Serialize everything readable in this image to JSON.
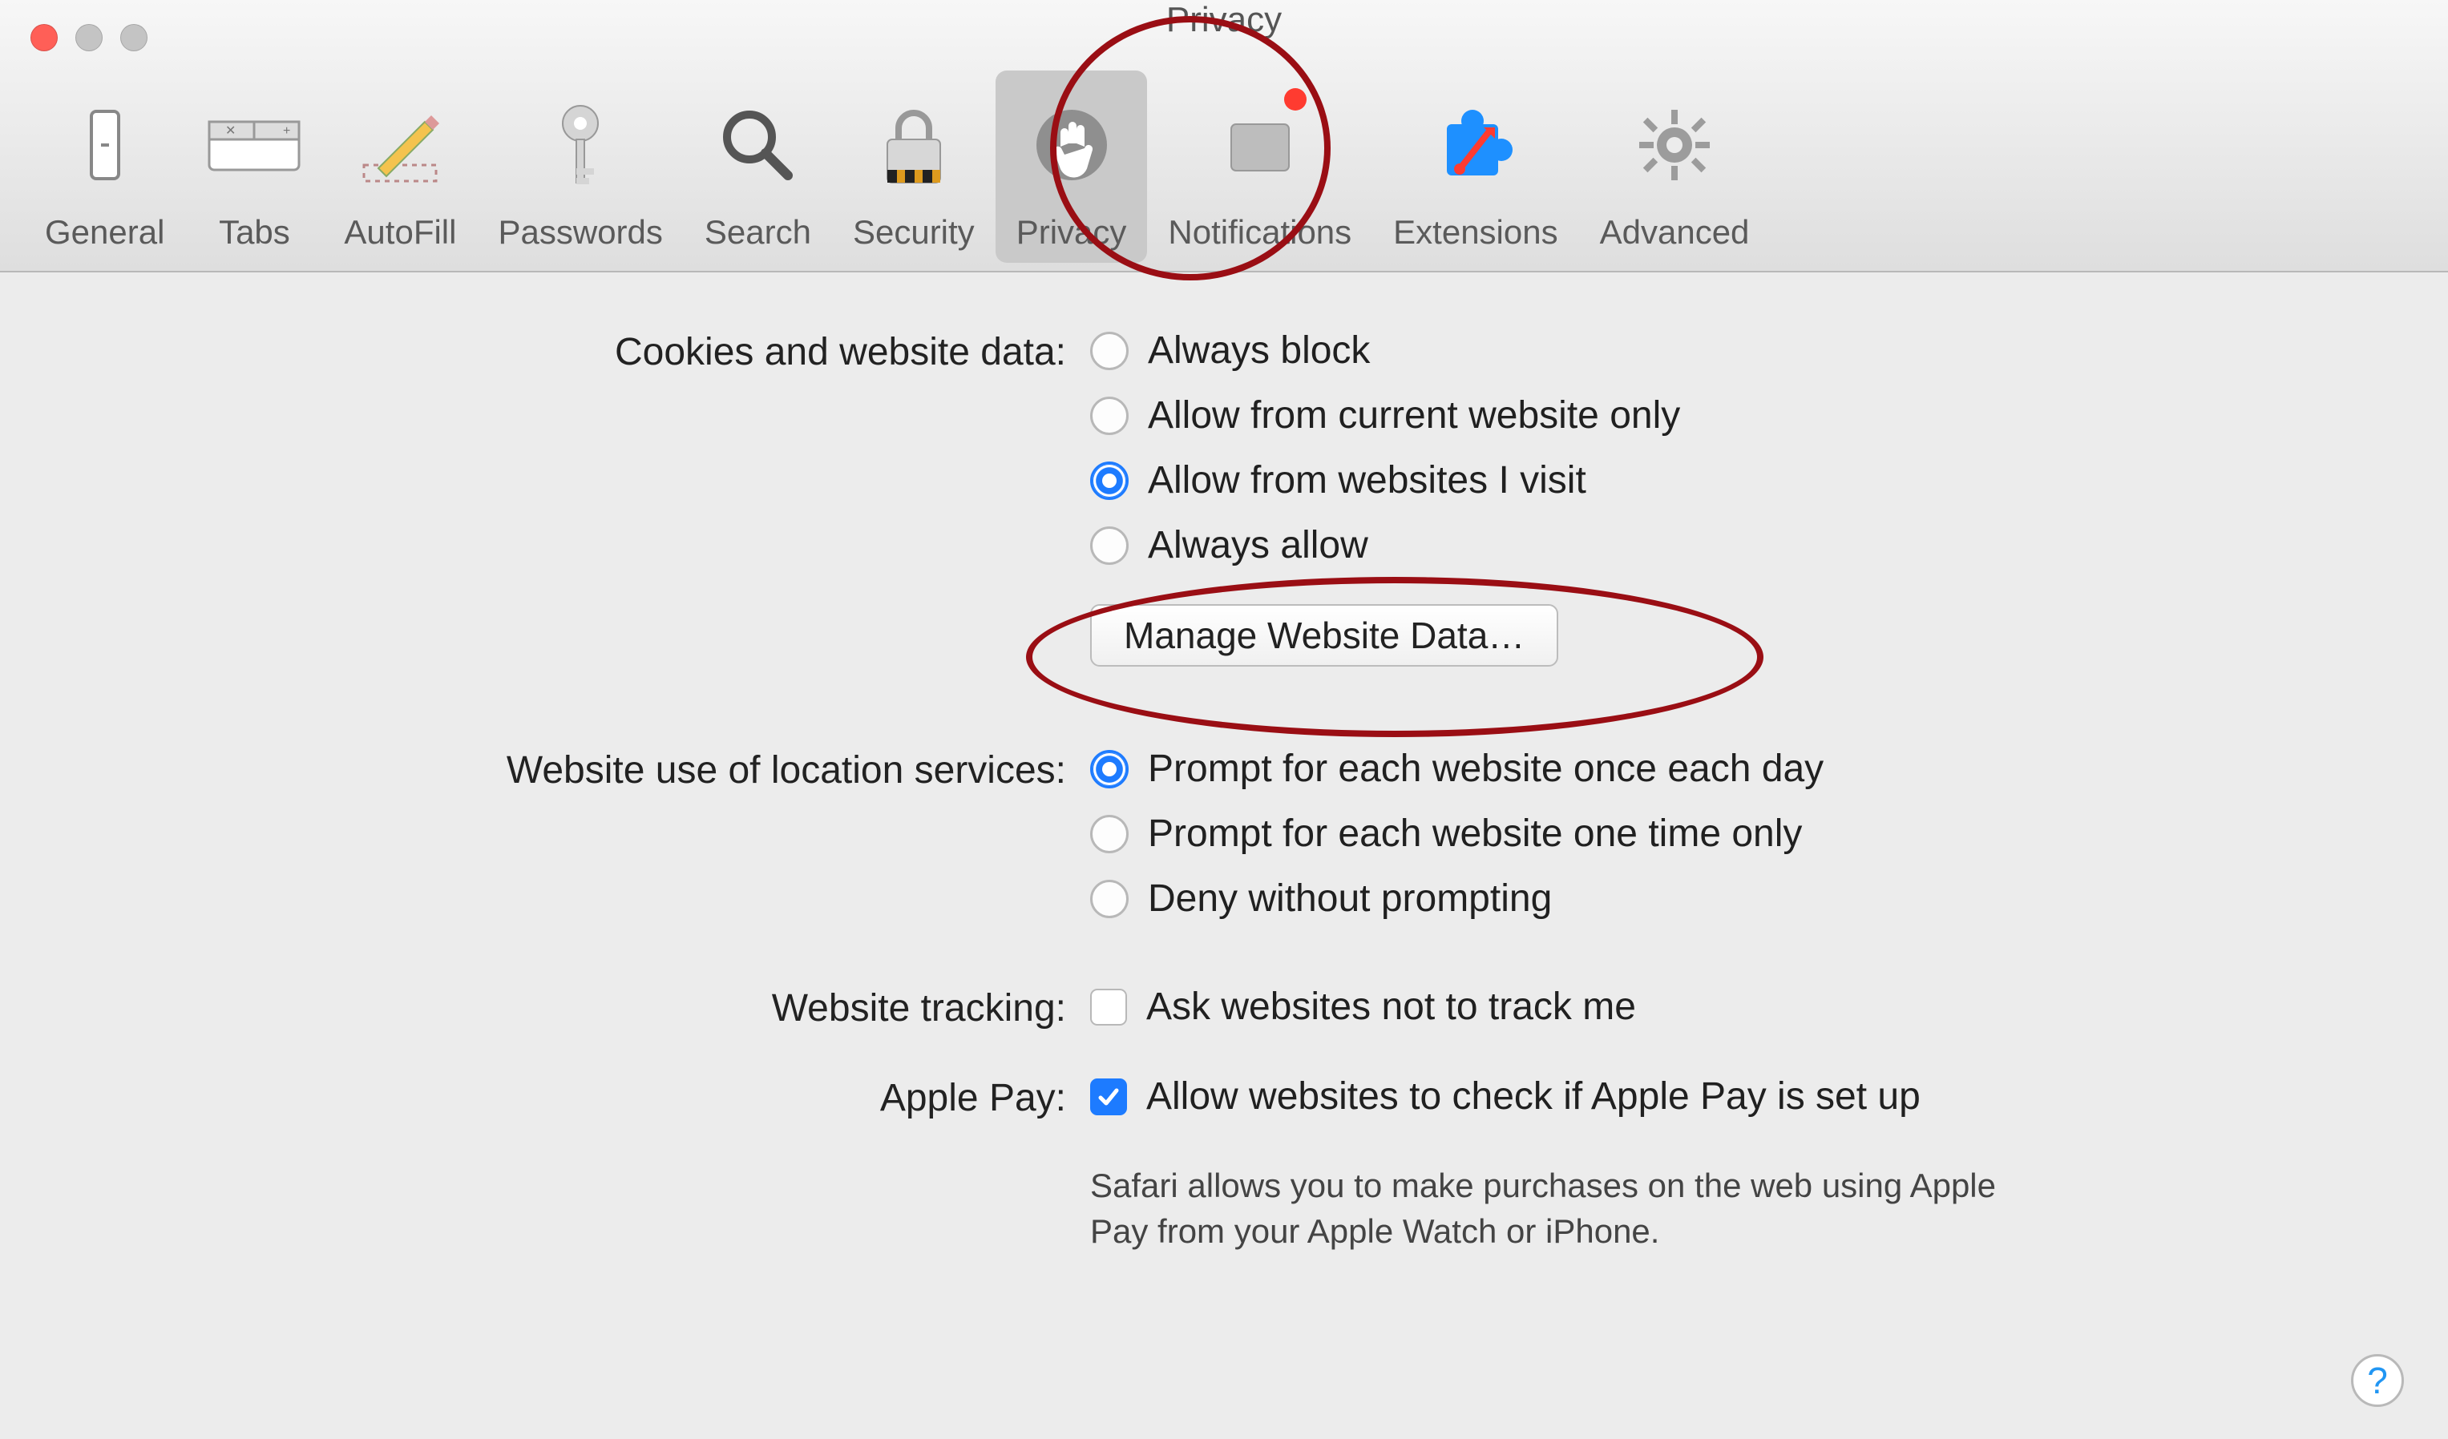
{
  "window": {
    "title": "Privacy"
  },
  "toolbar": {
    "tabs": [
      {
        "label": "General",
        "icon": "general"
      },
      {
        "label": "Tabs",
        "icon": "tabs"
      },
      {
        "label": "AutoFill",
        "icon": "autofill"
      },
      {
        "label": "Passwords",
        "icon": "passwords"
      },
      {
        "label": "Search",
        "icon": "search"
      },
      {
        "label": "Security",
        "icon": "security"
      },
      {
        "label": "Privacy",
        "icon": "privacy",
        "active": true
      },
      {
        "label": "Notifications",
        "icon": "notifications",
        "badge": true
      },
      {
        "label": "Extensions",
        "icon": "extensions"
      },
      {
        "label": "Advanced",
        "icon": "advanced"
      }
    ]
  },
  "sections": {
    "cookies": {
      "label": "Cookies and website data:",
      "options": [
        "Always block",
        "Allow from current website only",
        "Allow from websites I visit",
        "Always allow"
      ],
      "selected": 2,
      "button": "Manage Website Data…"
    },
    "location": {
      "label": "Website use of location services:",
      "options": [
        "Prompt for each website once each day",
        "Prompt for each website one time only",
        "Deny without prompting"
      ],
      "selected": 0
    },
    "tracking": {
      "label": "Website tracking:",
      "option": "Ask websites not to track me",
      "checked": false
    },
    "applepay": {
      "label": "Apple Pay:",
      "option": "Allow websites to check if Apple Pay is set up",
      "checked": true,
      "note": "Safari allows you to make purchases on the web using Apple Pay from your Apple Watch or iPhone."
    }
  },
  "help": "?"
}
